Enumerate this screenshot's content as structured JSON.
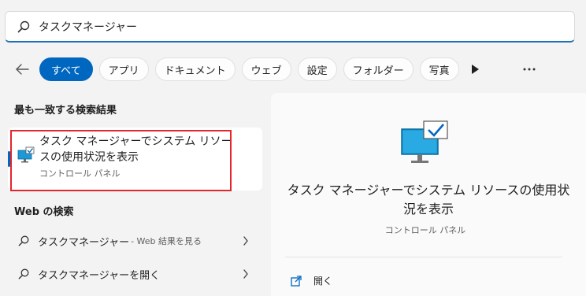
{
  "search": {
    "value": "タスクマネージャー",
    "icon": "search-icon"
  },
  "filters": {
    "back_icon": "back-arrow-icon",
    "chips": [
      {
        "label": "すべて",
        "active": true
      },
      {
        "label": "アプリ",
        "active": false
      },
      {
        "label": "ドキュメント",
        "active": false
      },
      {
        "label": "ウェブ",
        "active": false
      },
      {
        "label": "設定",
        "active": false
      },
      {
        "label": "フォルダー",
        "active": false
      },
      {
        "label": "写真",
        "active": false
      }
    ],
    "play_icon": "play-more-icon",
    "more_icon": "ellipsis-icon"
  },
  "best_match": {
    "heading": "最も一致する検索結果",
    "item": {
      "title": "タスク マネージャーでシステム リソースの使用状況を表示",
      "subtitle": "コントロール パネル",
      "icon": "monitor-check-icon"
    }
  },
  "web_search": {
    "heading": "Web の検索",
    "items": [
      {
        "main": "タスクマネージャー",
        "suffix": " - Web 結果を見る",
        "icon": "search-icon"
      },
      {
        "main": "タスクマネージャーを開く",
        "suffix": "",
        "icon": "search-icon"
      }
    ]
  },
  "preview": {
    "title": "タスク マネージャーでシステム リソースの使用状況を表示",
    "subtitle": "コントロール パネル",
    "action_label": "開く",
    "action_icon": "open-external-icon"
  },
  "colors": {
    "accent": "#0067c0",
    "highlight_box": "#e3262c",
    "background": "#f3f3f3"
  }
}
